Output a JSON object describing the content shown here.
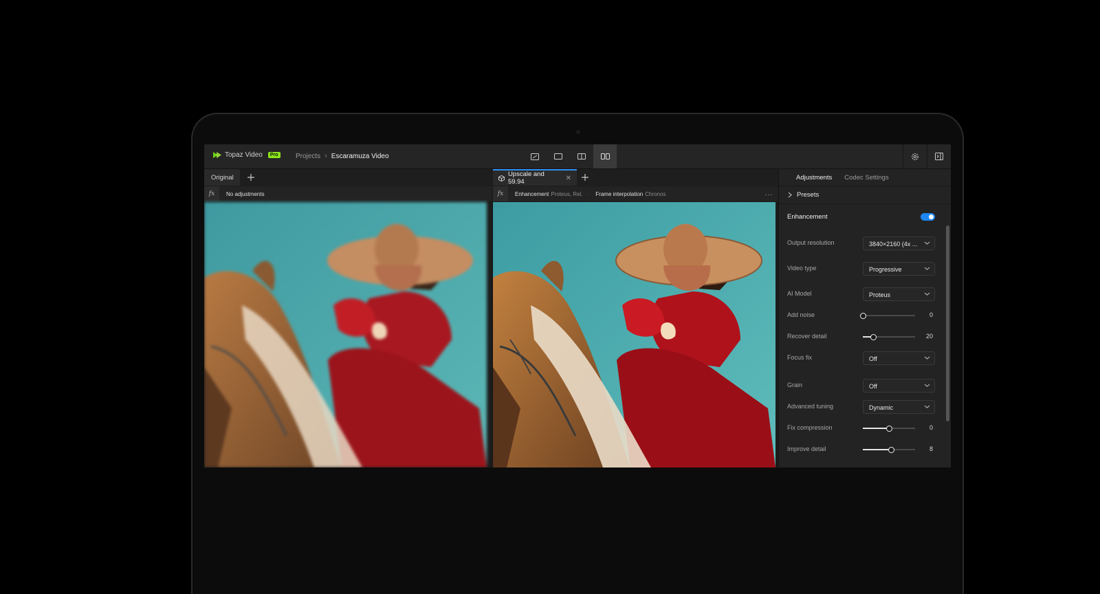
{
  "app": {
    "name": "Topaz Video",
    "badge": "Pro"
  },
  "breadcrumb": [
    "Projects",
    "Escaramuza Video"
  ],
  "view_modes": [
    {
      "icon": "crop-view-icon",
      "active": false
    },
    {
      "icon": "single-view-icon",
      "active": false
    },
    {
      "icon": "split-view-icon",
      "active": false
    },
    {
      "icon": "side-by-side-view-icon",
      "active": true
    }
  ],
  "toolbar_right": [
    {
      "icon": "gear-icon"
    },
    {
      "icon": "panel-toggle-icon"
    }
  ],
  "tabs": {
    "original": "Original",
    "upscale": "Upscale and 59.94"
  },
  "left_fx": {
    "label": "No adjustments"
  },
  "right_fx": {
    "items": [
      {
        "label": "Enhancement",
        "value": "Proteus, Rel."
      },
      {
        "label": "Frame interpolation",
        "value": "Chronos"
      }
    ],
    "more": "..."
  },
  "panel": {
    "tabs": [
      "Adjustments",
      "Codec Settings"
    ],
    "presets": "Presets",
    "section": "Enhancement",
    "section_enabled": true,
    "rows": [
      {
        "label": "Output resolution",
        "kind": "select",
        "value": "3840×2160 (4x ..."
      },
      {
        "label": "Video type",
        "kind": "select",
        "value": "Progressive"
      },
      {
        "label": "AI Model",
        "kind": "select",
        "value": "Proteus"
      },
      {
        "label": "Add noise",
        "kind": "slider",
        "value": "0",
        "fraction": 0.0
      },
      {
        "label": "Recover detail",
        "kind": "slider",
        "value": "20",
        "fraction": 0.2
      },
      {
        "label": "Focus fix",
        "kind": "select",
        "value": "Off"
      },
      {
        "label": "Grain",
        "kind": "select",
        "value": "Off"
      },
      {
        "label": "Advanced tuning",
        "kind": "select",
        "value": "Dynamic"
      },
      {
        "label": "Fix compression",
        "kind": "slider",
        "value": "0",
        "fraction": 0.5
      },
      {
        "label": "Improve detail",
        "kind": "slider",
        "value": "8",
        "fraction": 0.54
      }
    ]
  },
  "colors": {
    "accent": "#1d86f0",
    "pro_badge": "#8be51c",
    "sky": "#47a5a8",
    "dress": "#b0141c"
  }
}
